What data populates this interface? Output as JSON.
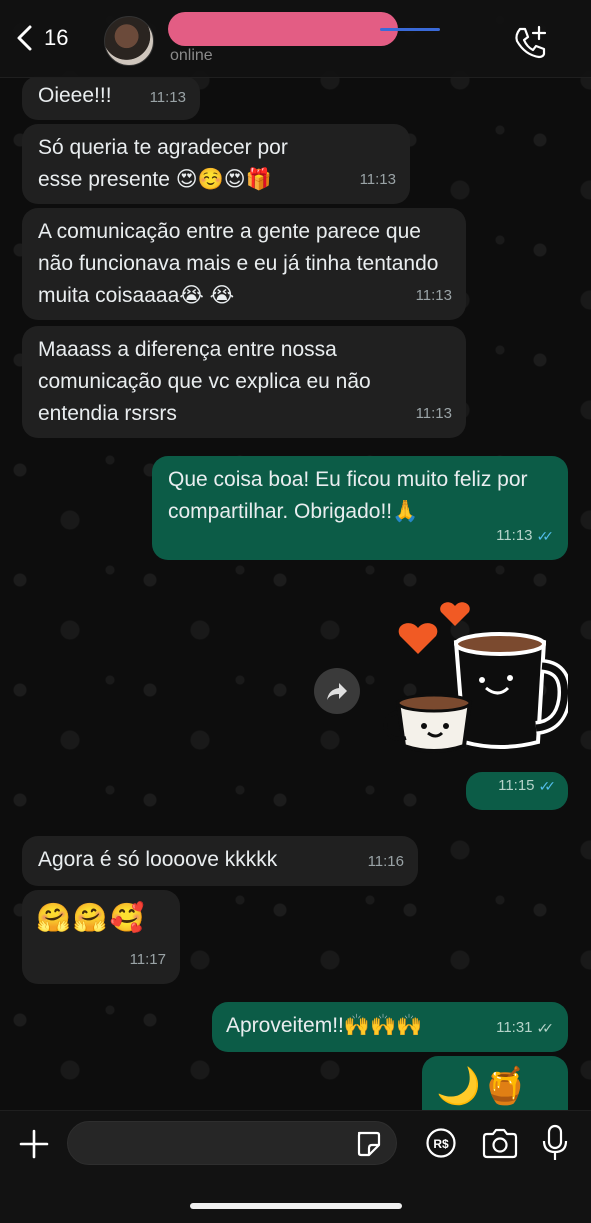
{
  "header": {
    "back_count": "16",
    "status": "online"
  },
  "messages": [
    {
      "dir": "in",
      "text": "Oieee!!!",
      "time": "11:13"
    },
    {
      "dir": "in",
      "text": "Só queria te agradecer por esse presente 😍☺️😍🎁",
      "time": "11:13"
    },
    {
      "dir": "in",
      "text": "A comunicação entre a gente parece que não funcionava mais e eu já tinha tentando muita coisaaaa😭 😭",
      "time": "11:13"
    },
    {
      "dir": "in",
      "text": "Maaass a diferença entre nossa comunicação que vc explica eu não entendia rsrsrs",
      "time": "11:13"
    },
    {
      "dir": "out",
      "text": "Que coisa boa! Eu ficou muito feliz por compartilhar. Obrigado!!🙏",
      "time": "11:13",
      "read": true
    },
    {
      "dir": "out",
      "text": "",
      "time": "11:15",
      "read": true
    },
    {
      "dir": "in",
      "text": "Agora é só loooove kkkkk",
      "time": "11:16"
    },
    {
      "dir": "in",
      "text": "🤗🤗🥰",
      "time": "11:17"
    },
    {
      "dir": "out",
      "text": "Aproveitem!!🙌🙌🙌",
      "time": "11:31",
      "read": false
    },
    {
      "dir": "out",
      "text": "🌙🍯",
      "time": ""
    }
  ],
  "colors": {
    "incoming_bubble": "#202020",
    "outgoing_bubble": "#0c5c47",
    "read_ticks": "#53bdeb"
  },
  "icons": {
    "back": "chevron-left-icon",
    "call": "phone-plus-icon",
    "attach": "plus-icon",
    "sticker": "sticker-icon",
    "payment": "rs-money-icon",
    "camera": "camera-icon",
    "mic": "microphone-icon",
    "forward": "forward-icon"
  }
}
